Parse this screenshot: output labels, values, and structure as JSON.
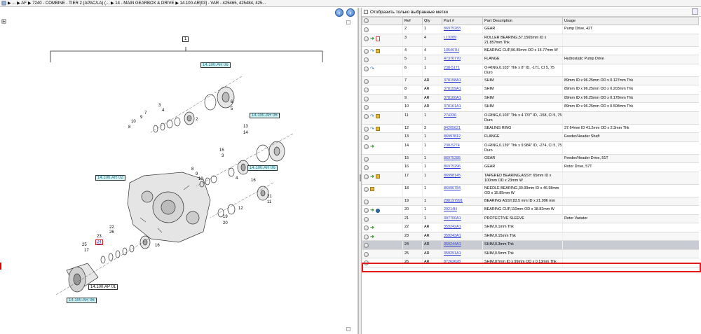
{
  "breadcrumb": {
    "items": [
      "▶ ...",
      "▶ AF",
      "▶ 7240 - COMBINE - TIER 2 (APAC/LA) (...",
      "▶ 14 - MAIN GEARBOX & DRIVE",
      "▶ 14.100.AR[03] - VAR - 425465, 425484, 425..."
    ]
  },
  "diagram": {
    "callouts": {
      "c1": "14.100.AR 06",
      "c2": "14.100.AR 06",
      "c3": "14.100.AR 06",
      "c4": "14.100.AR 02",
      "c5": "14.100.AP 01",
      "c6": "14.100.AR 06",
      "assembly": "1"
    },
    "labels": [
      "2",
      "3",
      "4",
      "5",
      "6",
      "7",
      "8",
      "9",
      "10",
      "11",
      "12",
      "13",
      "14",
      "15",
      "16",
      "17",
      "18",
      "19",
      "20",
      "21",
      "22",
      "23",
      "24",
      "25",
      "26"
    ],
    "selected_label": "24"
  },
  "filter": {
    "label": "Отобразить только выбранные метки"
  },
  "table": {
    "headers": [
      "Ref",
      "Qty",
      "Part #",
      "Part Description",
      "Usage"
    ],
    "rows": [
      {
        "ref": "2",
        "qty": "1",
        "part": "86975283",
        "desc": "GEAR",
        "usage": "Pump Drive, 42T",
        "icons": [],
        "tall": false
      },
      {
        "ref": "3",
        "qty": "4",
        "part": "L13289",
        "desc": "ROLLER BEARING,57.1565mm ID x 21.857mm Thk",
        "usage": "",
        "icons": [
          "arrow-g",
          "doc-r"
        ],
        "tall": true
      },
      {
        "ref": "4",
        "qty": "4",
        "part": "105497H",
        "desc": "BEARING CUP,96.85mm OD x 15.77mm W",
        "usage": "",
        "icons": [
          "arrow-b",
          "box-y"
        ],
        "tall": false
      },
      {
        "ref": "5",
        "qty": "1",
        "part": "47376770",
        "desc": "FLANGE",
        "usage": "Hydrostatic Pump Drive",
        "icons": [],
        "tall": false
      },
      {
        "ref": "6",
        "qty": "1",
        "part": "238-5171",
        "desc": "O-RING,0.103\" Thk x 8\" ID, -171, CI 5, 75 Duro",
        "usage": "",
        "icons": [
          "arrow-b"
        ],
        "tall": true
      },
      {
        "ref": "7",
        "qty": "AR",
        "part": "378158A1",
        "desc": "SHIM",
        "usage": "89mm ID x 96.25mm OD x 0.127mm Thk",
        "icons": [],
        "tall": false
      },
      {
        "ref": "8",
        "qty": "AR",
        "part": "378159A1",
        "desc": "SHIM",
        "usage": "89mm ID x 96.25mm OD x 0.203mm Thk",
        "icons": [],
        "tall": false
      },
      {
        "ref": "9",
        "qty": "AR",
        "part": "378160A1",
        "desc": "SHIM",
        "usage": "89mm ID x 96.25mm OD x 0.178mm Thk",
        "icons": [],
        "tall": false
      },
      {
        "ref": "10",
        "qty": "AR",
        "part": "378161A1",
        "desc": "SHIM",
        "usage": "89mm ID x 96.25mm OD x 0.508mm Thk",
        "icons": [],
        "tall": false
      },
      {
        "ref": "11",
        "qty": "1",
        "part": "274336",
        "desc": "O-RING,0.103\" Thk x 4.737\" ID, -158, CI 5, 75 Duro",
        "usage": "",
        "icons": [
          "arrow-b",
          "box-y"
        ],
        "tall": true
      },
      {
        "ref": "12",
        "qty": "3",
        "part": "84205621",
        "desc": "SEALING RING",
        "usage": "37.64mm ID 41.2mm OD x 2.3mm Thk",
        "icons": [
          "arrow-b",
          "box-y"
        ],
        "tall": false
      },
      {
        "ref": "13",
        "qty": "1",
        "part": "86997812",
        "desc": "FLANGE",
        "usage": "Feeder/Header Shaft",
        "icons": [],
        "tall": false
      },
      {
        "ref": "14",
        "qty": "1",
        "part": "238-5274",
        "desc": "O-RING,0.139\" Thk x 9.984\" ID, -274, CI 5, 75 Duro",
        "usage": "",
        "icons": [
          "arrow-g"
        ],
        "tall": true
      },
      {
        "ref": "15",
        "qty": "1",
        "part": "86975285",
        "desc": "GEAR",
        "usage": "Feeder/Header Drive, 51T",
        "icons": [],
        "tall": false
      },
      {
        "ref": "16",
        "qty": "1",
        "part": "86975296",
        "desc": "GEAR",
        "usage": "Rotor Drive, 57T",
        "icons": [],
        "tall": false
      },
      {
        "ref": "17",
        "qty": "1",
        "part": "86998145",
        "desc": "TAPERED BEARING,ASSY: 65mm ID x 100mm OD x 23mm W",
        "usage": "",
        "icons": [
          "arrow-g",
          "box-y"
        ],
        "tall": true
      },
      {
        "ref": "18",
        "qty": "1",
        "part": "86996784",
        "desc": "NEEDLE BEARING,39.99mm ID x 46.98mm OD x 15.85mm W",
        "usage": "",
        "icons": [
          "box-y"
        ],
        "tall": true
      },
      {
        "ref": "19",
        "qty": "1",
        "part": "298197991",
        "desc": "BEARING ASSY,83.5 mm ID x 21.996 mm",
        "usage": "",
        "icons": [],
        "tall": false
      },
      {
        "ref": "20",
        "qty": "1",
        "part": "29214H",
        "desc": "BEARING CUP,110mm OD x 18.82mm W",
        "usage": "",
        "icons": [
          "arrow-g",
          "globe"
        ],
        "tall": false
      },
      {
        "ref": "21",
        "qty": "1",
        "part": "397700A1",
        "desc": "PROTECTIVE SLEEVE",
        "usage": "Rotor Variator",
        "icons": [],
        "tall": false
      },
      {
        "ref": "22",
        "qty": "AR",
        "part": "359242A1",
        "desc": "SHIM,0.1mm Thk",
        "usage": "",
        "icons": [
          "arrow-g"
        ],
        "tall": false
      },
      {
        "ref": "23",
        "qty": "AR",
        "part": "359243A1",
        "desc": "SHIM,0.15mm Thk",
        "usage": "",
        "icons": [
          "arrow-g"
        ],
        "tall": false
      },
      {
        "ref": "24",
        "qty": "AR",
        "part": "359244A1",
        "desc": "SHIM,0.3mm Thk",
        "usage": "",
        "icons": [],
        "tall": false,
        "selected": true
      },
      {
        "ref": "25",
        "qty": "AR",
        "part": "359251A1",
        "desc": "SHIM,0.5mm Thk",
        "usage": "",
        "icons": [],
        "tall": false
      },
      {
        "ref": "26",
        "qty": "AR",
        "part": "87262628",
        "desc": "SHIM,87mm ID x 99mm OD x 0.13mm Thk",
        "usage": "",
        "icons": [],
        "tall": false
      }
    ]
  }
}
